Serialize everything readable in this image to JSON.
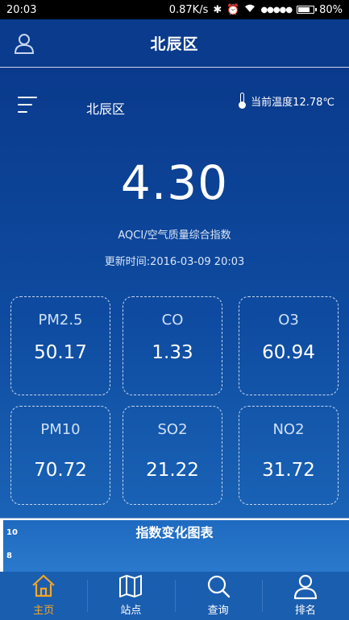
{
  "status_bar": {
    "time": "20:03",
    "speed": "0.87K/s",
    "signal": "●●●●●",
    "battery": "80%",
    "battery_level": 0.8
  },
  "app_bar": {
    "title": "北辰区"
  },
  "header": {
    "district": "北辰区",
    "temperature": "当前温度12.78℃"
  },
  "aqi": {
    "value": "4.30",
    "label": "AQCI/空气质量综合指数",
    "updated": "更新时间:2016-03-09 20:03"
  },
  "pollutants": [
    {
      "name": "PM2.5",
      "value": "50.17"
    },
    {
      "name": "CO",
      "value": "1.33"
    },
    {
      "name": "O3",
      "value": "60.94"
    },
    {
      "name": "PM10",
      "value": "70.72"
    },
    {
      "name": "SO2",
      "value": "21.22"
    },
    {
      "name": "NO2",
      "value": "31.72"
    }
  ],
  "chart": {
    "title": "指数变化图表",
    "ticks": [
      "10",
      "8"
    ]
  },
  "tabs": [
    {
      "label": "主页",
      "icon": "home-icon",
      "active": true
    },
    {
      "label": "站点",
      "icon": "map-icon",
      "active": false
    },
    {
      "label": "查询",
      "icon": "search-icon",
      "active": false
    },
    {
      "label": "排名",
      "icon": "person-icon",
      "active": false
    }
  ],
  "colors": {
    "primary": "#0a3b8c",
    "tab_bar": "#1a5eb0",
    "active_tab": "#f5a623"
  }
}
